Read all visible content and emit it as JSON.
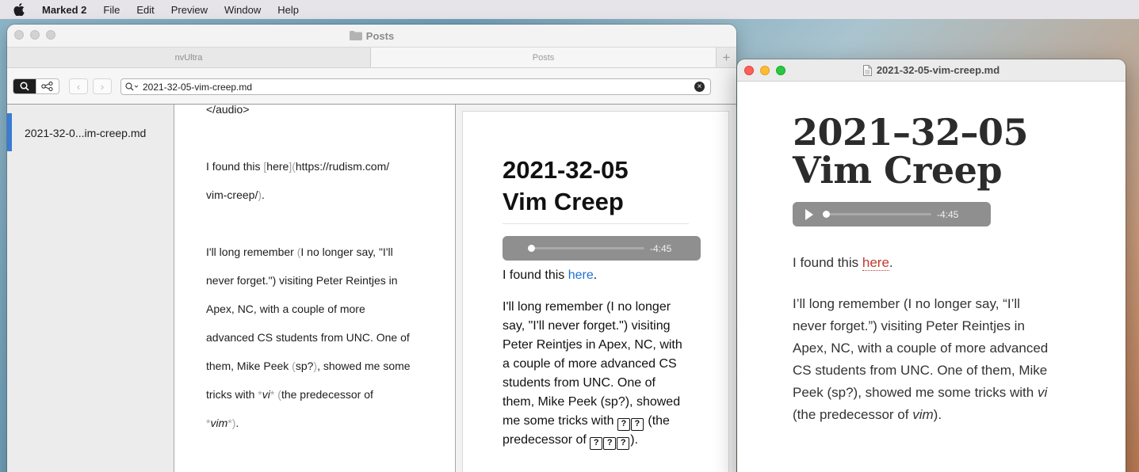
{
  "menubar": {
    "app_name": "Marked 2",
    "items": [
      "File",
      "Edit",
      "Preview",
      "Window",
      "Help"
    ]
  },
  "main_window": {
    "title": "Posts",
    "tabs": [
      "nvUltra",
      "Posts"
    ],
    "new_tab_label": "+",
    "search": {
      "value": "2021-32-05-vim-creep.md",
      "clear_label": "×"
    },
    "nav": {
      "back": "‹",
      "forward": "›"
    },
    "note_list": [
      {
        "title": "2021-32-0...im-creep.md"
      }
    ],
    "editor_lines": {
      "l1": "</audio>",
      "l2_a": "I found this ",
      "l2_b": "[",
      "l2_c": "here",
      "l2_d": "](",
      "l2_e": "https://rudism.com/",
      "l3_a": "vim-creep/",
      "l3_b": ")",
      "l3_c": ".",
      "l4_a": "I'll long remember ",
      "l4_b": "(",
      "l4_c": "I no longer say, \"I'll",
      "l5_a": "never forget.\")",
      "l5_b": " visiting Peter Reintjes in",
      "l6": "Apex, NC, with a couple of more",
      "l7": "advanced CS students from UNC.  One of",
      "l8_a": "them, Mike Peek ",
      "l8_b": "(",
      "l8_c": "sp?",
      "l8_d": ")",
      "l8_e": ", showed me some",
      "l9_a": "tricks with ",
      "l9_b": "*",
      "l9_c": "vi",
      "l9_d": "*",
      "l9_e": " ",
      "l9_f": "(",
      "l9_g": "the predecessor of",
      "l10_a": "*",
      "l10_b": "vim",
      "l10_c": "*",
      "l10_d": ")",
      "l10_e": "."
    },
    "preview": {
      "title_line1": "2021-32-05",
      "title_line2": "Vim Creep",
      "audio_time": "-4:45",
      "p1_a": "I found this ",
      "p1_link": "here",
      "p1_b": ".",
      "p2_l1": "I'll long remember (I no longer",
      "p2_l2": "say, \"I'll never forget.\") visiting",
      "p2_l3": "Peter Reintjes in Apex, NC, with",
      "p2_l4": "a couple of more advanced CS",
      "p2_l5": "students from UNC. One of",
      "p2_l6": "them, Mike Peek (sp?), showed",
      "p2_l7_a": "me some tricks with ",
      "p2_l7_b": " (the",
      "p2_l8_a": "predecessor of ",
      "p2_l8_b": ").",
      "tofu_glyph": "?"
    }
  },
  "marked_window": {
    "title": "2021-32-05-vim-creep.md",
    "heading_line1": "2021–32–05",
    "heading_line2": "Vim Creep",
    "audio_time": "-4:45",
    "p1_a": "I found this ",
    "p1_link": "here",
    "p1_b": ".",
    "p2_l1": "I’ll long remember (I no longer say, “I’ll",
    "p2_l2": "never forget.”) visiting Peter Reintjes in",
    "p2_l3": "Apex, NC, with a couple of more advanced",
    "p2_l4": "CS students from UNC. One of them, Mike",
    "p2_l5_a": "Peek (sp?), showed me some tricks with ",
    "p2_l5_b": "vi",
    "p2_l6_a": "(the predecessor of ",
    "p2_l6_b": "vim",
    "p2_l6_c": ")."
  },
  "colors": {
    "link_blue": "#1f6fd1",
    "link_red": "#c0392b",
    "selection_blue": "#3a7bd5"
  }
}
